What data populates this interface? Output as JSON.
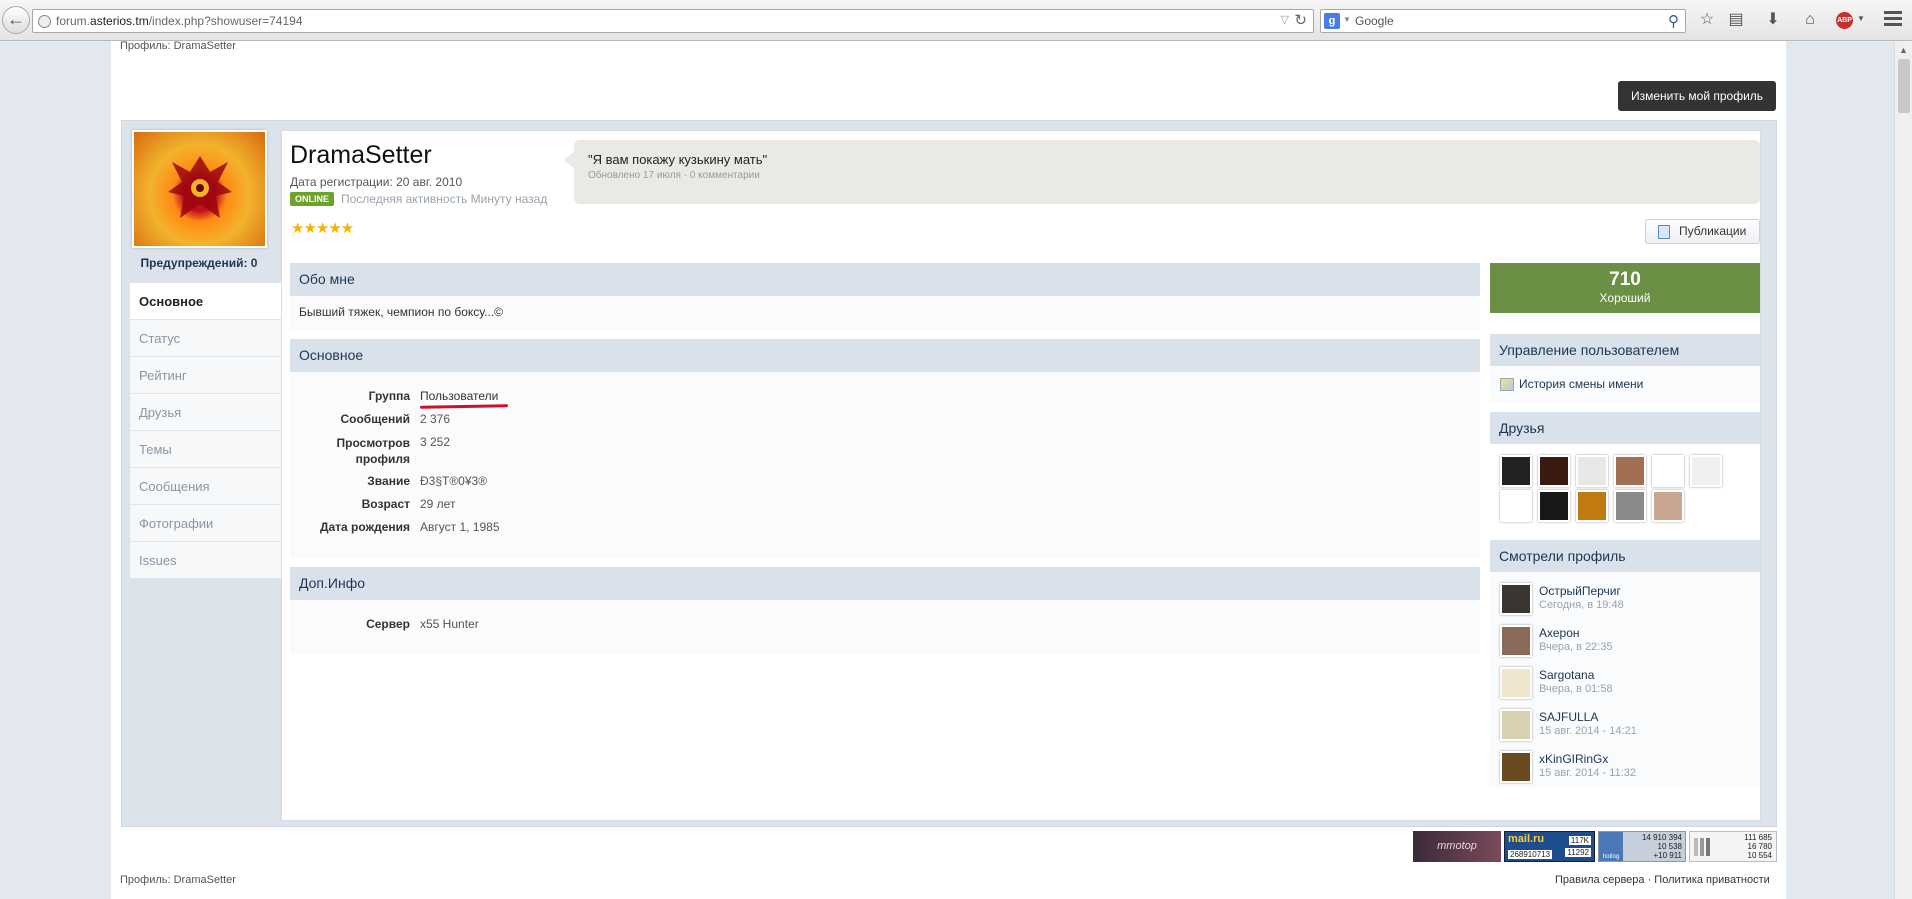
{
  "browser": {
    "url_prefix": "forum.",
    "url_host": "asterios.tm",
    "url_path": "/index.php?showuser=74194",
    "search_placeholder": "Google",
    "search_engine_letter": "g",
    "abp_label": "ABP"
  },
  "page": {
    "breadcrumb_top": "Профиль: DramaSetter",
    "edit_profile_button": "Изменить мой профиль",
    "footer_breadcrumb": "Профиль: DramaSetter",
    "footer_links": "Правила сервера · Политика приватности"
  },
  "profile": {
    "username": "DramaSetter",
    "registration": "Дата регистрации: 20 авг. 2010",
    "online_badge": "ONLINE",
    "last_activity": "Последняя активность Минуту назад",
    "rating_stars": "★★★★★",
    "warnings": "Предупреждений: 0",
    "status_text": "\"Я вам покажу кузькину мать\"",
    "status_meta": "Обновлено 17 июля · 0 комментарии",
    "publications_button": "Публикации"
  },
  "tabs": [
    {
      "label": "Основное",
      "active": true
    },
    {
      "label": "Статус",
      "active": false
    },
    {
      "label": "Рейтинг",
      "active": false
    },
    {
      "label": "Друзья",
      "active": false
    },
    {
      "label": "Темы",
      "active": false
    },
    {
      "label": "Сообщения",
      "active": false
    },
    {
      "label": "Фотографии",
      "active": false
    },
    {
      "label": "Issues",
      "active": false
    }
  ],
  "about": {
    "title": "Обо мне",
    "text": "Бывший тяжек, чемпион по боксу...©"
  },
  "basic": {
    "title": "Основное",
    "rows": [
      {
        "label": "Группа",
        "value": "Пользователи"
      },
      {
        "label": "Сообщений",
        "value": "2 376"
      },
      {
        "label": "Просмотров профиля",
        "value": "3 252"
      },
      {
        "label": "Звание",
        "value": "Ð3§T®0¥3®"
      },
      {
        "label": "Возраст",
        "value": "29 лет"
      },
      {
        "label": "Дата рождения",
        "value": "Август 1, 1985"
      }
    ]
  },
  "extra": {
    "title": "Доп.Инфо",
    "rows": [
      {
        "label": "Сервер",
        "value": "x55 Hunter"
      }
    ]
  },
  "reputation": {
    "value": "710",
    "label": "Хороший",
    "color": "#6b8f45"
  },
  "sidebar": {
    "manage_title": "Управление пользователем",
    "name_history_link": "История смены имени",
    "friends_title": "Друзья",
    "friend_colors": [
      "#222222",
      "#3a1a10",
      "#e8e8e8",
      "#a07050",
      "#ffffff",
      "#f0f0f0",
      "#ffffff",
      "#181818",
      "#c07a10",
      "#8a8a8a",
      "#c9a690"
    ],
    "visitors_title": "Смотрели профиль",
    "visitors": [
      {
        "name": "ОстрыйПерчиг",
        "time": "Сегодня, в 19:48",
        "color": "#3a3530"
      },
      {
        "name": "Ахерон",
        "time": "Вчера, в 22:35",
        "color": "#8a6a5a"
      },
      {
        "name": "Sargotana",
        "time": "Вчера, в 01:58",
        "color": "#f0e6d0"
      },
      {
        "name": "SAJFULLA",
        "time": "15 авг. 2014 - 14:21",
        "color": "#d8d2b0"
      },
      {
        "name": "xKinGIRinGx",
        "time": "15 авг. 2014 - 11:32",
        "color": "#6a4a20"
      }
    ]
  },
  "counters": {
    "mmotop_label": "mmotop",
    "mailru_label": "mail.ru",
    "mailru_number": "268910713",
    "mailru_stat1": "117K",
    "mailru_stat2": "11292",
    "hotlog_label": "hotlog",
    "hotlog_1": "14 910 394",
    "hotlog_2": "10 538",
    "hotlog_3": "+10 911",
    "li_1": "111 685",
    "li_2": "16 780",
    "li_3": "10 554"
  }
}
